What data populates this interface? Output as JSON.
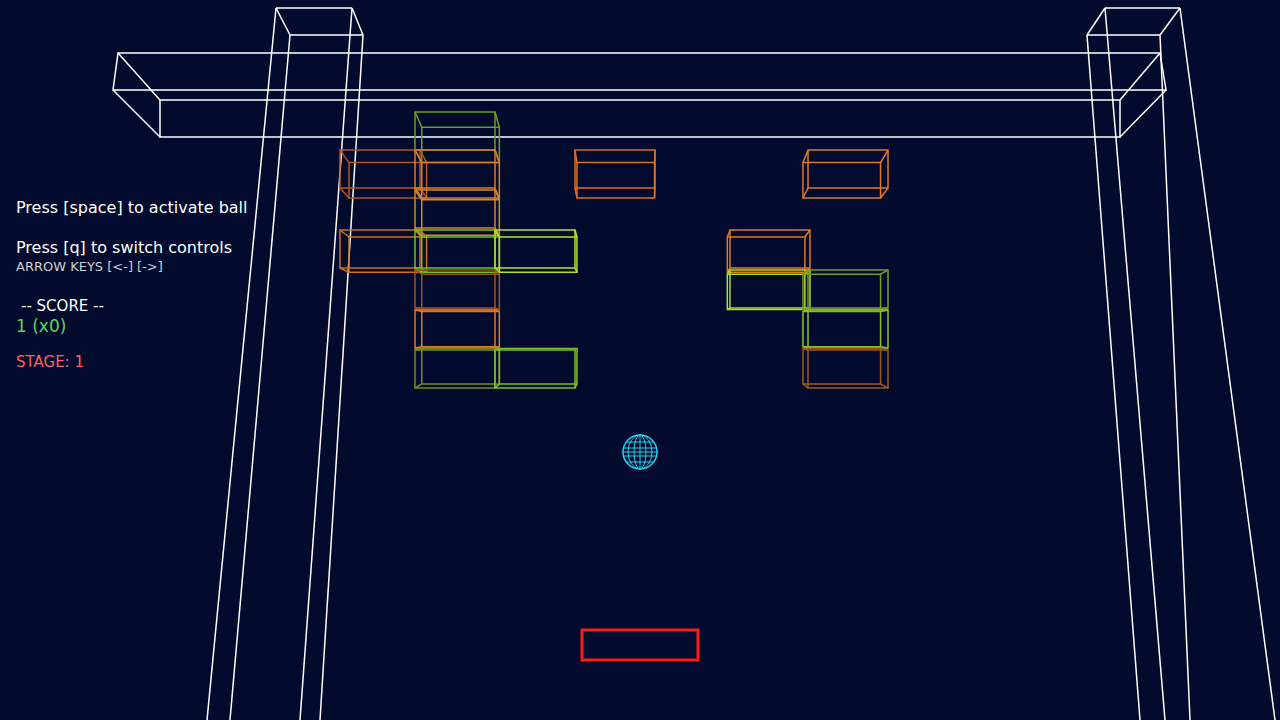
{
  "hud": {
    "activate_hint": "Press [space] to activate ball",
    "controls_hint": "Press [q] to switch controls",
    "controls_mode": "ARROW KEYS [<-] [->]",
    "score_label": "-- SCORE --",
    "score": "1 (x0)",
    "stage": "STAGE: 1"
  },
  "bricks": [
    {
      "col": 1,
      "row": 0,
      "color": "#6f9a22"
    },
    {
      "col": 0,
      "row": 1,
      "color": "#b5561c"
    },
    {
      "col": 1,
      "row": 1,
      "color": "#e07a1f"
    },
    {
      "col": 1,
      "row": 2,
      "color": "#d08a1f"
    },
    {
      "col": 0,
      "row": 3,
      "color": "#d0701f"
    },
    {
      "col": 1,
      "row": 3,
      "color": "#6fc02a"
    },
    {
      "col": 2,
      "row": 3,
      "color": "#b5e02a"
    },
    {
      "col": 1,
      "row": 4,
      "color": "#a0521c"
    },
    {
      "col": 1,
      "row": 5,
      "color": "#e07a1f"
    },
    {
      "col": 1,
      "row": 6,
      "color": "#7a8a1f"
    },
    {
      "col": 2,
      "row": 6,
      "color": "#7ac02a"
    },
    {
      "col": 3,
      "row": 1,
      "color": "#e0701f"
    },
    {
      "col": 5,
      "row": 1,
      "color": "#e07a1f"
    },
    {
      "col": 4,
      "row": 3,
      "color": "#e07a1f"
    },
    {
      "col": 4,
      "row": 4,
      "color": "#a8e02a"
    },
    {
      "col": 5,
      "row": 4,
      "color": "#7a9a22"
    },
    {
      "col": 5,
      "row": 5,
      "color": "#8ac02a"
    },
    {
      "col": 5,
      "row": 6,
      "color": "#9a5a1c"
    }
  ]
}
